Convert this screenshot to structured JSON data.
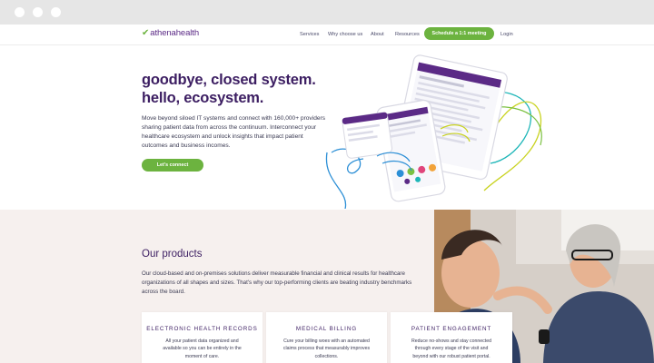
{
  "header": {
    "logo_text": "athenahealth",
    "nav": [
      "Services",
      "Why choose us",
      "About",
      "Resources"
    ],
    "cta": "Schedule a 1:1 meeting",
    "login": "Login"
  },
  "hero": {
    "title_line1": "goodbye, closed system.",
    "title_line2": "hello, ecosystem.",
    "body": "Move beyond siloed IT systems and connect with 160,000+ providers sharing patient data from across the continuum. Interconnect your healthcare ecosystem and unlock insights that impact patient outcomes and business incomes.",
    "cta": "Let's connect"
  },
  "products": {
    "title": "Our products",
    "body": "Our cloud-based and on-premises solutions deliver measurable financial and clinical results for healthcare organizations of all shapes and sizes. That's why our top-performing clients are beating industry benchmarks across the board.",
    "cards": [
      {
        "title": "ELECTRONIC HEALTH RECORDS",
        "text": "All your patient data organized and available so you can be entirely in the moment of care."
      },
      {
        "title": "MEDICAL BILLING",
        "text": "Cure your billing woes with an automated claims process that measurably improves collections."
      },
      {
        "title": "PATIENT ENGAGEMENT",
        "text": "Reduce no-shows and stay connected through every stage of the visit and beyond with our robust patient portal."
      }
    ]
  },
  "colors": {
    "brand_purple": "#3c1e62",
    "brand_green": "#6cb33f",
    "section_bg": "#f6f0ee"
  },
  "icons": [
    "window-dot-icon",
    "athena-leaf-icon"
  ]
}
